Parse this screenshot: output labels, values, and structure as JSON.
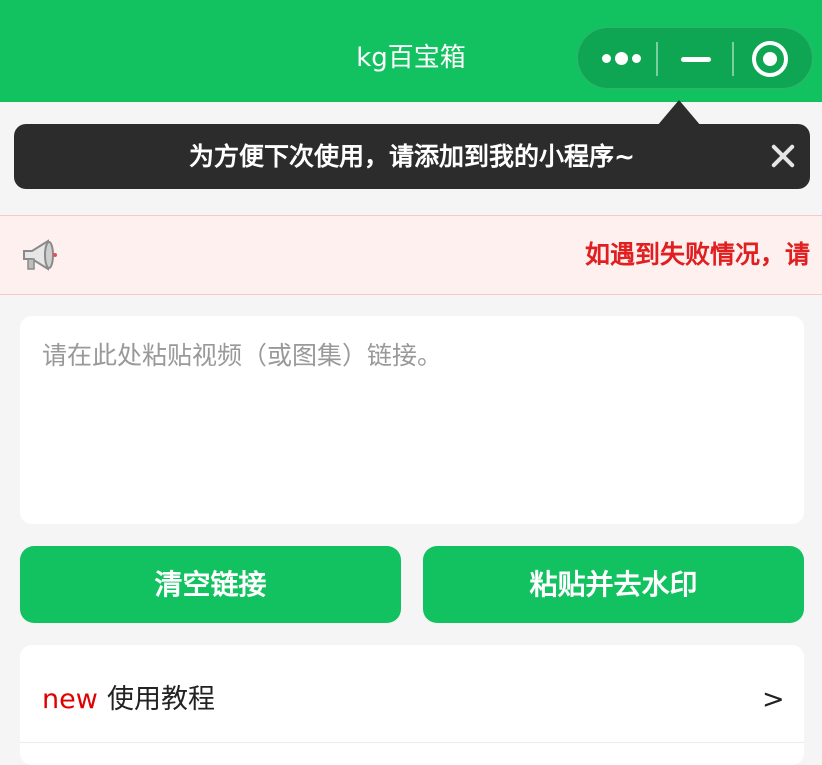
{
  "header": {
    "title": "kg百宝箱",
    "background_color": "#12c260",
    "capsule": {
      "more_icon": "more-dots-icon",
      "minimize_icon": "minus-icon",
      "close_icon": "target-circle-icon"
    }
  },
  "tip": {
    "text": "为方便下次使用，请添加到我的小程序~",
    "close_icon": "close-x-icon"
  },
  "notice": {
    "icon": "megaphone-icon",
    "text": "如遇到失败情况，请",
    "color": "#e02020"
  },
  "link_input": {
    "placeholder": "请在此处粘贴视频（或图集）链接。",
    "value": ""
  },
  "buttons": {
    "clear_label": "清空链接",
    "paste_label": "粘贴并去水印"
  },
  "menu": {
    "items": [
      {
        "badge": "new",
        "label": "使用教程",
        "arrow": ">"
      }
    ]
  }
}
